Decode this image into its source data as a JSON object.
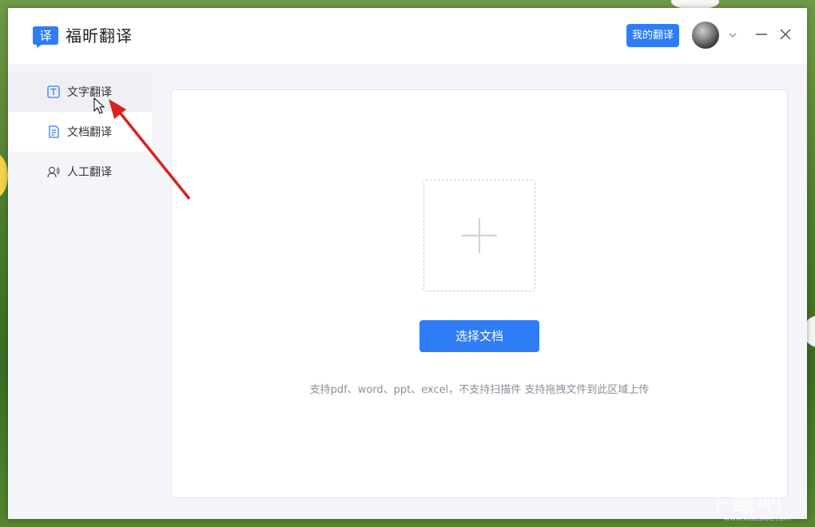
{
  "app": {
    "title": "福昕翻译",
    "logo_icon": "translate-logo-icon",
    "logo_glyph": "译"
  },
  "header": {
    "my_translate_label": "我的翻译"
  },
  "sidebar": {
    "items": [
      {
        "label": "文字翻译",
        "icon": "text-T-icon"
      },
      {
        "label": "文档翻译",
        "icon": "document-icon"
      },
      {
        "label": "人工翻译",
        "icon": "human-voice-icon"
      }
    ]
  },
  "main": {
    "select_doc_label": "选择文档",
    "hint": "支持pdf、word、ppt、excel，不支持扫描件 支持拖拽文件到此区域上传"
  },
  "watermark": {
    "text": "下载吧",
    "sub": "www.xiazaiba.com"
  },
  "colors": {
    "accent": "#2f7df6",
    "arrow": "#d9231f"
  }
}
